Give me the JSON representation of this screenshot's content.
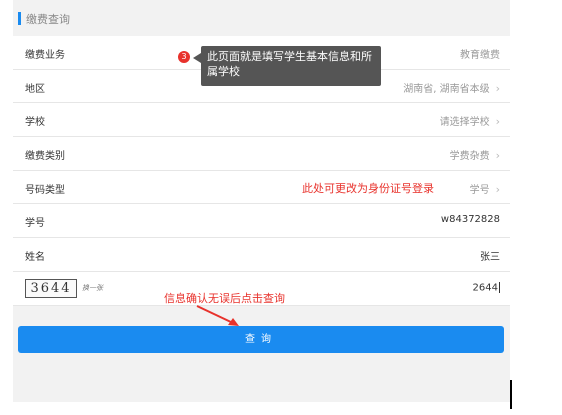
{
  "section": {
    "title": "缴费查询"
  },
  "rows": [
    {
      "label": "缴费业务",
      "value": "教育缴费"
    },
    {
      "label": "地区",
      "value": "湖南省, 湖南省本级"
    },
    {
      "label": "学校",
      "value": "请选择学校"
    },
    {
      "label": "缴费类别",
      "value": "学费杂费"
    },
    {
      "label": "号码类型",
      "value": "学号"
    },
    {
      "label": "学号",
      "value": "w84372828"
    },
    {
      "label": "姓名",
      "value": "张三"
    }
  ],
  "captcha": {
    "image_text": "3644",
    "refresh_label": "换一张",
    "value": "2644"
  },
  "submit": {
    "label": "查询"
  },
  "annotations": {
    "step_number": "3",
    "tooltip": "此页面就是填写学生基本信息和所属学校",
    "number_type_note": "此处可更改为身份证号登录",
    "confirm_note": "信息确认无误后点击查询"
  },
  "colors": {
    "accent": "#1a8bf0",
    "annotation": "#e8322c"
  }
}
